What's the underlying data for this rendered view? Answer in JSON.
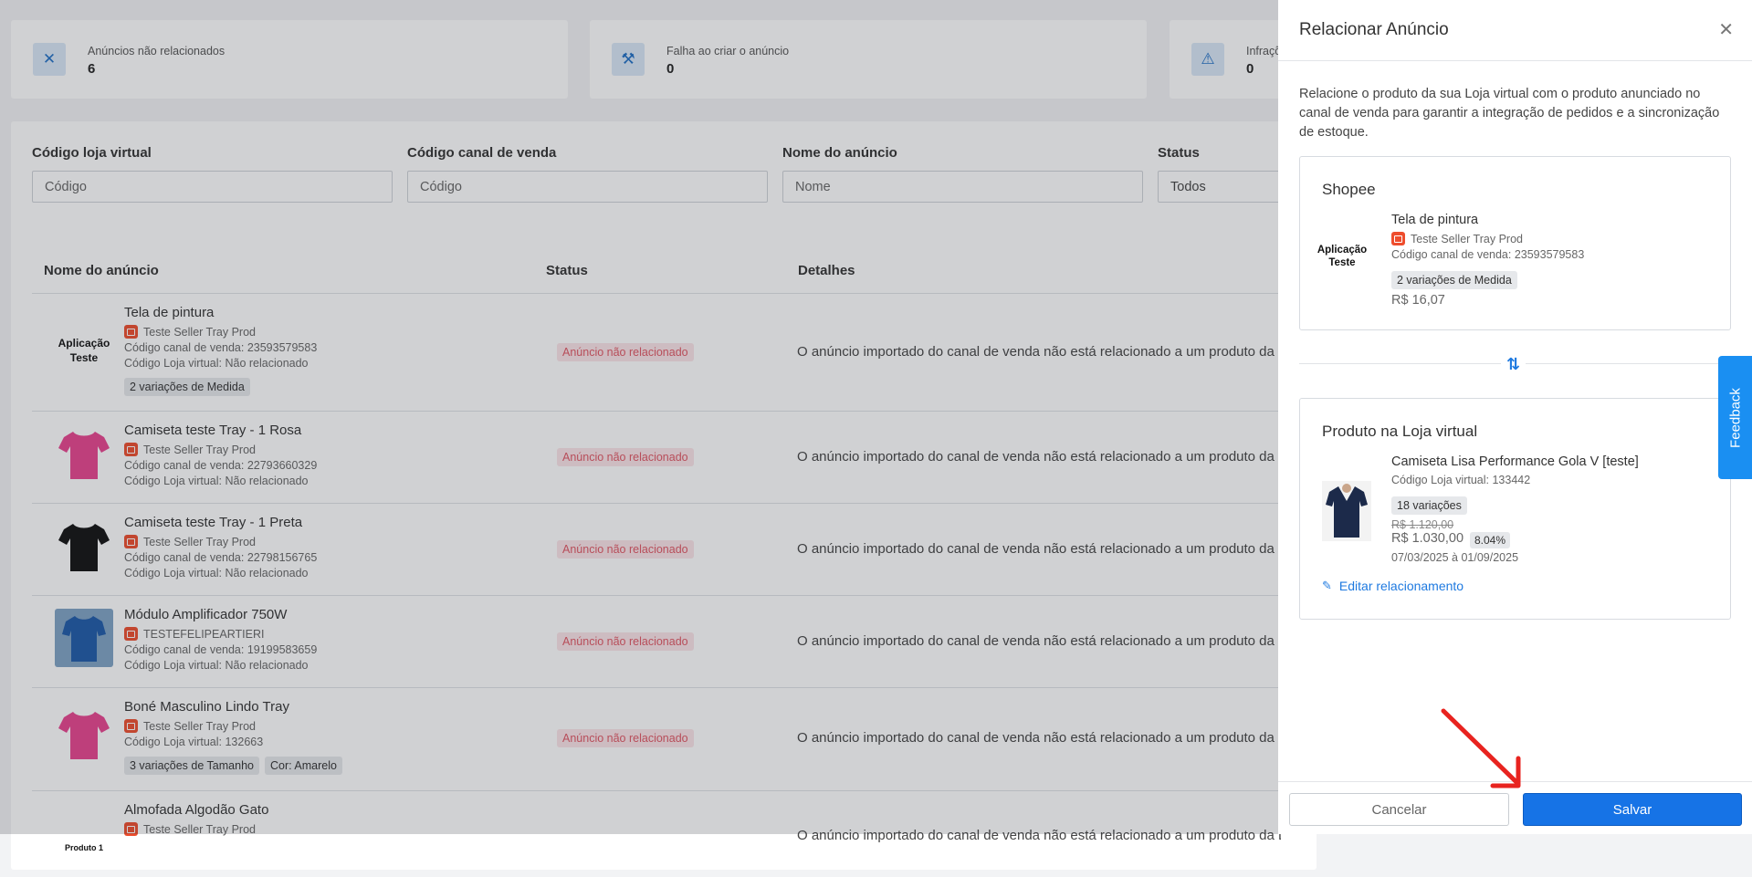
{
  "stats": [
    {
      "icon": "close-icon",
      "label": "Anúncios não relacionados",
      "value": "6"
    },
    {
      "icon": "tools-icon",
      "label": "Falha ao criar o anúncio",
      "value": "0"
    },
    {
      "icon": "warning-icon",
      "label": "Infrações",
      "value": "0"
    }
  ],
  "filters": {
    "loja": {
      "label": "Código loja virtual",
      "placeholder": "Código"
    },
    "canal": {
      "label": "Código canal de venda",
      "placeholder": "Código"
    },
    "nome": {
      "label": "Nome do anúncio",
      "placeholder": "Nome"
    },
    "status": {
      "label": "Status",
      "value": "Todos"
    }
  },
  "table": {
    "headers": [
      "Nome do anúncio",
      "Status",
      "Detalhes"
    ],
    "detail_text": "O anúncio importado do canal de venda não está relacionado a um produto da Loja virtual",
    "status_text": "Anúncio não relacionado",
    "rows": [
      {
        "thumb": "Aplicação Teste",
        "name": "Tela de pintura",
        "seller": "Teste Seller Tray Prod",
        "canal": "Código canal de venda: 23593579583",
        "loja": "Código Loja virtual: Não relacionado",
        "tags": [
          "2 variações de Medida"
        ]
      },
      {
        "thumb": "pink-shirt",
        "name": "Camiseta teste Tray - 1 Rosa",
        "seller": "Teste Seller Tray Prod",
        "canal": "Código canal de venda: 22793660329",
        "loja": "Código Loja virtual: Não relacionado",
        "tags": []
      },
      {
        "thumb": "black-shirt",
        "name": "Camiseta teste Tray - 1 Preta",
        "seller": "Teste Seller Tray Prod",
        "canal": "Código canal de venda: 22798156765",
        "loja": "Código Loja virtual: Não relacionado",
        "tags": []
      },
      {
        "thumb": "blue-shirt",
        "name": "Módulo Amplificador 750W",
        "seller": "TESTEFELIPEARTIERI",
        "canal": "Código canal de venda: 19199583659",
        "loja": "Código Loja virtual: Não relacionado",
        "tags": []
      },
      {
        "thumb": "pink-shirt",
        "name": "Boné Masculino Lindo Tray",
        "seller": "Teste Seller Tray Prod",
        "canal": "Código Loja virtual: 132663",
        "loja": "",
        "tags": [
          "3 variações de Tamanho",
          "Cor: Amarelo"
        ]
      },
      {
        "thumb": "Produto 1",
        "name": "Almofada Algodão Gato",
        "seller": "Teste Seller Tray Prod",
        "canal": "",
        "loja": "",
        "tags": []
      }
    ]
  },
  "drawer": {
    "title": "Relacionar Anúncio",
    "description": "Relacione o produto da sua Loja virtual com o produto anunciado no canal de venda para garantir a integração de pedidos e a sincronização de estoque.",
    "shopee": {
      "heading": "Shopee",
      "logo": "Aplicação Teste",
      "name": "Tela de pintura",
      "seller": "Teste Seller Tray Prod",
      "code": "Código canal de venda: 23593579583",
      "tag": "2 variações de Medida",
      "price": "R$ 16,07"
    },
    "loja": {
      "heading": "Produto na Loja virtual",
      "name": "Camiseta Lisa Performance Gola V [teste]",
      "code": "Código Loja virtual: 133442",
      "tag": "18 variações",
      "old_price": "R$ 1.120,00",
      "price": "R$ 1.030,00",
      "discount": "8.04%",
      "dates": "07/03/2025 à 01/09/2025",
      "edit": "Editar relacionamento"
    },
    "cancel": "Cancelar",
    "save": "Salvar"
  },
  "feedback": "Feedback",
  "colors": {
    "primary": "#1673e6",
    "danger": "#e05764",
    "shopee": "#ee4d2d",
    "annotation": "#e8231f"
  }
}
